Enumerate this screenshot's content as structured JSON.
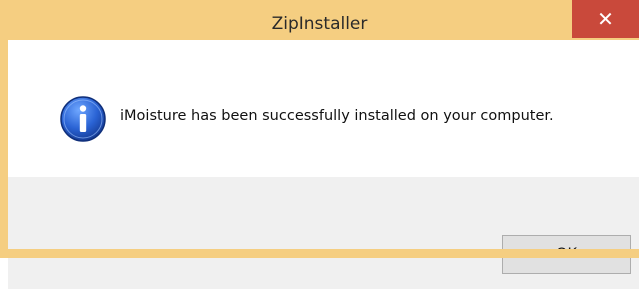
{
  "window": {
    "title": "ZipInstaller",
    "close_glyph": "✕"
  },
  "dialog": {
    "icon": "information-icon",
    "message": "iMoisture has been successfully installed on your computer.",
    "ok_label": "OK"
  },
  "colors": {
    "frame": "#f5ce81",
    "close_button": "#c9493b",
    "footer": "#f0f0f0",
    "button_face": "#e1e1e1"
  }
}
